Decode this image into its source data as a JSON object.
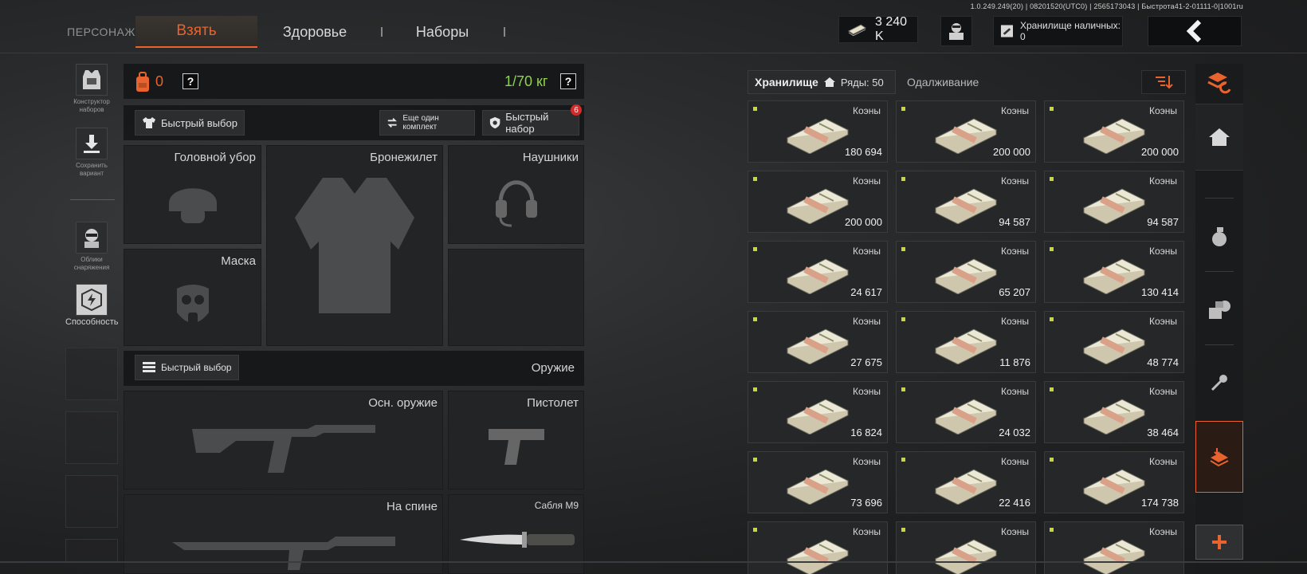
{
  "version": "1.0.249.249(20) | 08201520(UTC0) | 2565173043 | Быстрота41-2-01111-0|1001ru",
  "nav": {
    "character": "ПЕРСОНАЖ",
    "take": "Взять",
    "health": "Здоровье",
    "sets": "Наборы"
  },
  "topbar": {
    "money": "3 240 K",
    "cash_storage": "Хранилище наличных: 0"
  },
  "left_tools": [
    {
      "label": "Конструктор наборов",
      "icon": "vest-icon"
    },
    {
      "label": "Сохранить вариант",
      "icon": "download-icon"
    },
    {
      "label": "Облики снаряжения",
      "icon": "operator-icon"
    },
    {
      "label": "Способность",
      "icon": "ability-icon"
    }
  ],
  "loadout": {
    "backpack_count": "0",
    "weight": "1/70 кг",
    "quick_select": "Быстрый выбор",
    "another_set": "Еще один комплект",
    "quick_set": "Быстрый набор",
    "quick_set_badge": "6",
    "slots": {
      "headwear": "Головной убор",
      "armor": "Бронежилет",
      "headphones": "Наушники",
      "mask": "Маска",
      "weapon_quick": "Быстрый выбор",
      "weapons": "Оружие",
      "primary": "Осн. оружие",
      "pistol": "Пистолет",
      "back": "На спине",
      "melee": "Сабля M9"
    }
  },
  "storage": {
    "tab_storage": "Хранилище",
    "rows_label": "Ряды: 50",
    "tab_borrow": "Одалживание",
    "item_name": "Коэны",
    "items": [
      "180 694",
      "200 000",
      "200 000",
      "200 000",
      "94 587",
      "94 587",
      "24 617",
      "65 207",
      "130 414",
      "27 675",
      "11 876",
      "48 774",
      "16 824",
      "24 032",
      "38 464",
      "73 696",
      "22 416",
      "174 738",
      "",
      "",
      ""
    ]
  },
  "colors": {
    "accent": "#e8632e",
    "weight_green": "#8fd14f",
    "item_dot": "#c6d54a"
  }
}
